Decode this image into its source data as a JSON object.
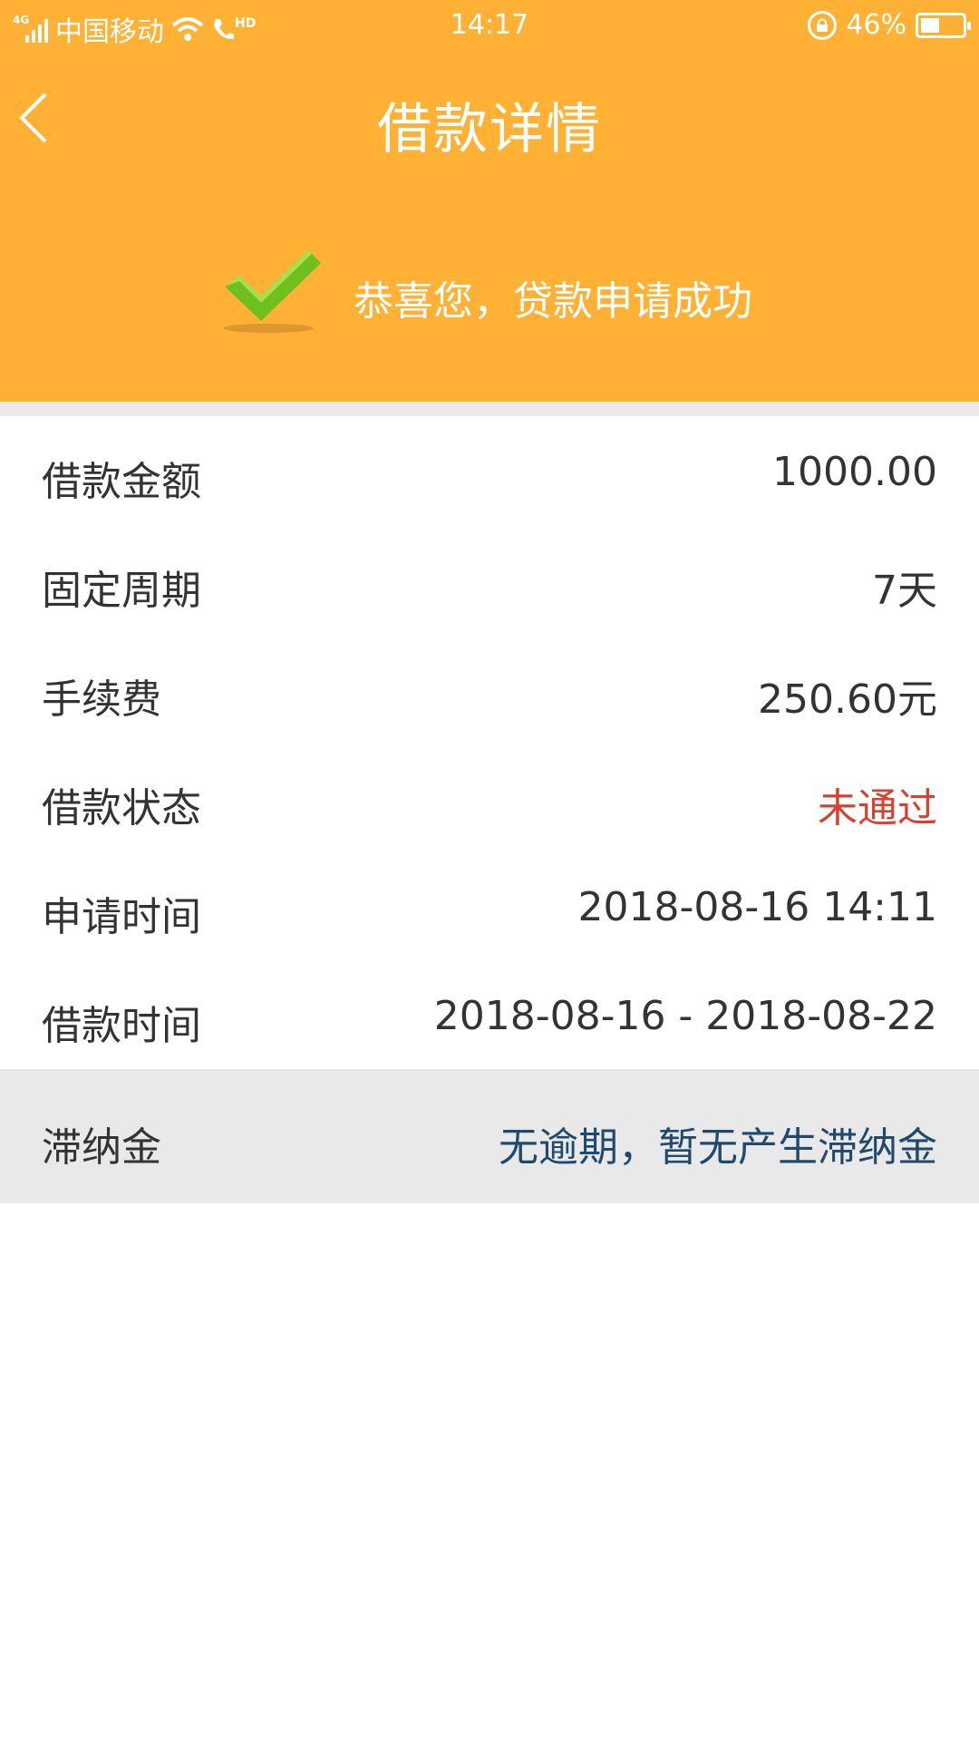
{
  "status_bar": {
    "network_tag": "4G",
    "carrier": "中国移动",
    "hd_tag": "HD",
    "time": "14:17",
    "battery": "46%",
    "battery_level": 0.46
  },
  "header": {
    "title": "借款详情",
    "success_message": "恭喜您，贷款申请成功",
    "background_color": "#ffb136"
  },
  "details": [
    {
      "label": "借款金额",
      "value": "1000.00"
    },
    {
      "label": "固定周期",
      "value": "7天"
    },
    {
      "label": "手续费",
      "value": "250.60元"
    },
    {
      "label": "借款状态",
      "value": "未通过",
      "value_color": "#d8402f"
    },
    {
      "label": "申请时间",
      "value": "2018-08-16 14:11"
    },
    {
      "label": "借款时间",
      "value": "2018-08-16 - 2018-08-22"
    }
  ],
  "late_fee": {
    "label": "滞纳金",
    "value": "无逾期，暂无产生滞纳金",
    "value_color": "#1f4a6d"
  },
  "icons": {
    "back": "chevron-left",
    "success": "green-checkmark",
    "wifi": "wifi",
    "phone": "phone-hd",
    "rotation_lock": "rotation-lock",
    "battery": "battery"
  }
}
